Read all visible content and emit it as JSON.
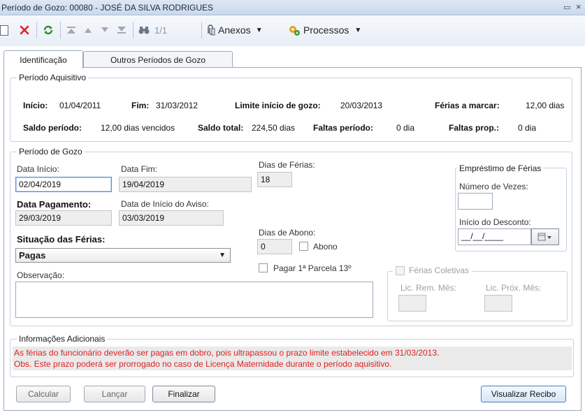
{
  "window": {
    "title": "Período de Gozo: 00080 - JOSÉ DA SILVA RODRIGUES",
    "restore_icon": "▭",
    "close_icon": "×"
  },
  "toolbar": {
    "page_indicator": "1/1",
    "attachments_label": "Anexos",
    "processes_label": "Processos"
  },
  "tabs": [
    {
      "label": "Identificação",
      "active": true
    },
    {
      "label": "Outros Períodos de Gozo",
      "active": false
    }
  ],
  "periodo_aquisitivo": {
    "title": "Período Aquisitivo",
    "inicio_label": "Início:",
    "inicio_value": "01/04/2011",
    "fim_label": "Fim:",
    "fim_value": "31/03/2012",
    "limite_label": "Limite início de gozo:",
    "limite_value": "20/03/2013",
    "ferias_marcar_label": "Férias a marcar:",
    "ferias_marcar_value": "12,00 dias",
    "saldo_periodo_label": "Saldo período:",
    "saldo_periodo_value": "12,00 dias vencidos",
    "saldo_total_label": "Saldo total:",
    "saldo_total_value": "224,50 dias",
    "faltas_periodo_label": "Faltas período:",
    "faltas_periodo_value": "0 dia",
    "faltas_prop_label": "Faltas prop.:",
    "faltas_prop_value": "0 dia"
  },
  "periodo_gozo": {
    "title": "Período de Gozo",
    "data_inicio_label": "Data Início:",
    "data_inicio_value": "02/04/2019",
    "data_fim_label": "Data Fim:",
    "data_fim_value": "19/04/2019",
    "dias_ferias_label": "Dias de Férias:",
    "dias_ferias_value": "18",
    "data_pagamento_label": "Data Pagamento:",
    "data_pagamento_value": "29/03/2019",
    "data_aviso_label": "Data de Início do Aviso:",
    "data_aviso_value": "03/03/2019",
    "situacao_label": "Situação das Férias:",
    "situacao_value": "Pagas",
    "dias_abono_label": "Dias de Abono:",
    "dias_abono_value": "0",
    "abono_label": "Abono",
    "pagar_parcela_label": "Pagar 1ª Parcela 13º",
    "observacao_label": "Observação:",
    "observacao_value": ""
  },
  "emprestimo": {
    "title": "Empréstimo de Férias",
    "numero_vezes_label": "Número de Vezes:",
    "numero_vezes_value": "",
    "inicio_desconto_label": "Início do Desconto:",
    "inicio_desconto_value": "__/__/____"
  },
  "ferias_coletivas": {
    "title": "Férias Coletivas",
    "lic_rem_label": "Lic. Rem. Mês:",
    "lic_prox_label": "Lic. Próx. Mês:"
  },
  "informacoes": {
    "title": "Informações Adicionais",
    "line1": "As férias do funcionário deverão ser pagas em dobro, pois ultrapassou o prazo limite estabelecido em 31/03/2013.",
    "line2": "Obs. Este prazo poderá ser prorrogado no caso de Licença Maternidade durante o período aquisitivo.",
    "text_color": "#e02020"
  },
  "buttons": {
    "calcular": "Calcular",
    "lancar": "Lançar",
    "finalizar": "Finalizar",
    "visualizar": "Visualizar Recibo"
  },
  "icons": {
    "new": "new-document-icon",
    "delete": "delete-x-icon",
    "refresh": "refresh-icon",
    "first": "first-record-icon",
    "previous": "previous-record-icon",
    "next": "next-record-icon",
    "last": "last-record-icon",
    "search": "binoculars-icon",
    "attachments": "paperclip-icon",
    "processes": "gears-icon",
    "calendar": "calendar-icon"
  },
  "colors": {
    "accent": "#4a7fb5",
    "delete_red": "#e02020",
    "refresh_green": "#2e8b2e"
  }
}
